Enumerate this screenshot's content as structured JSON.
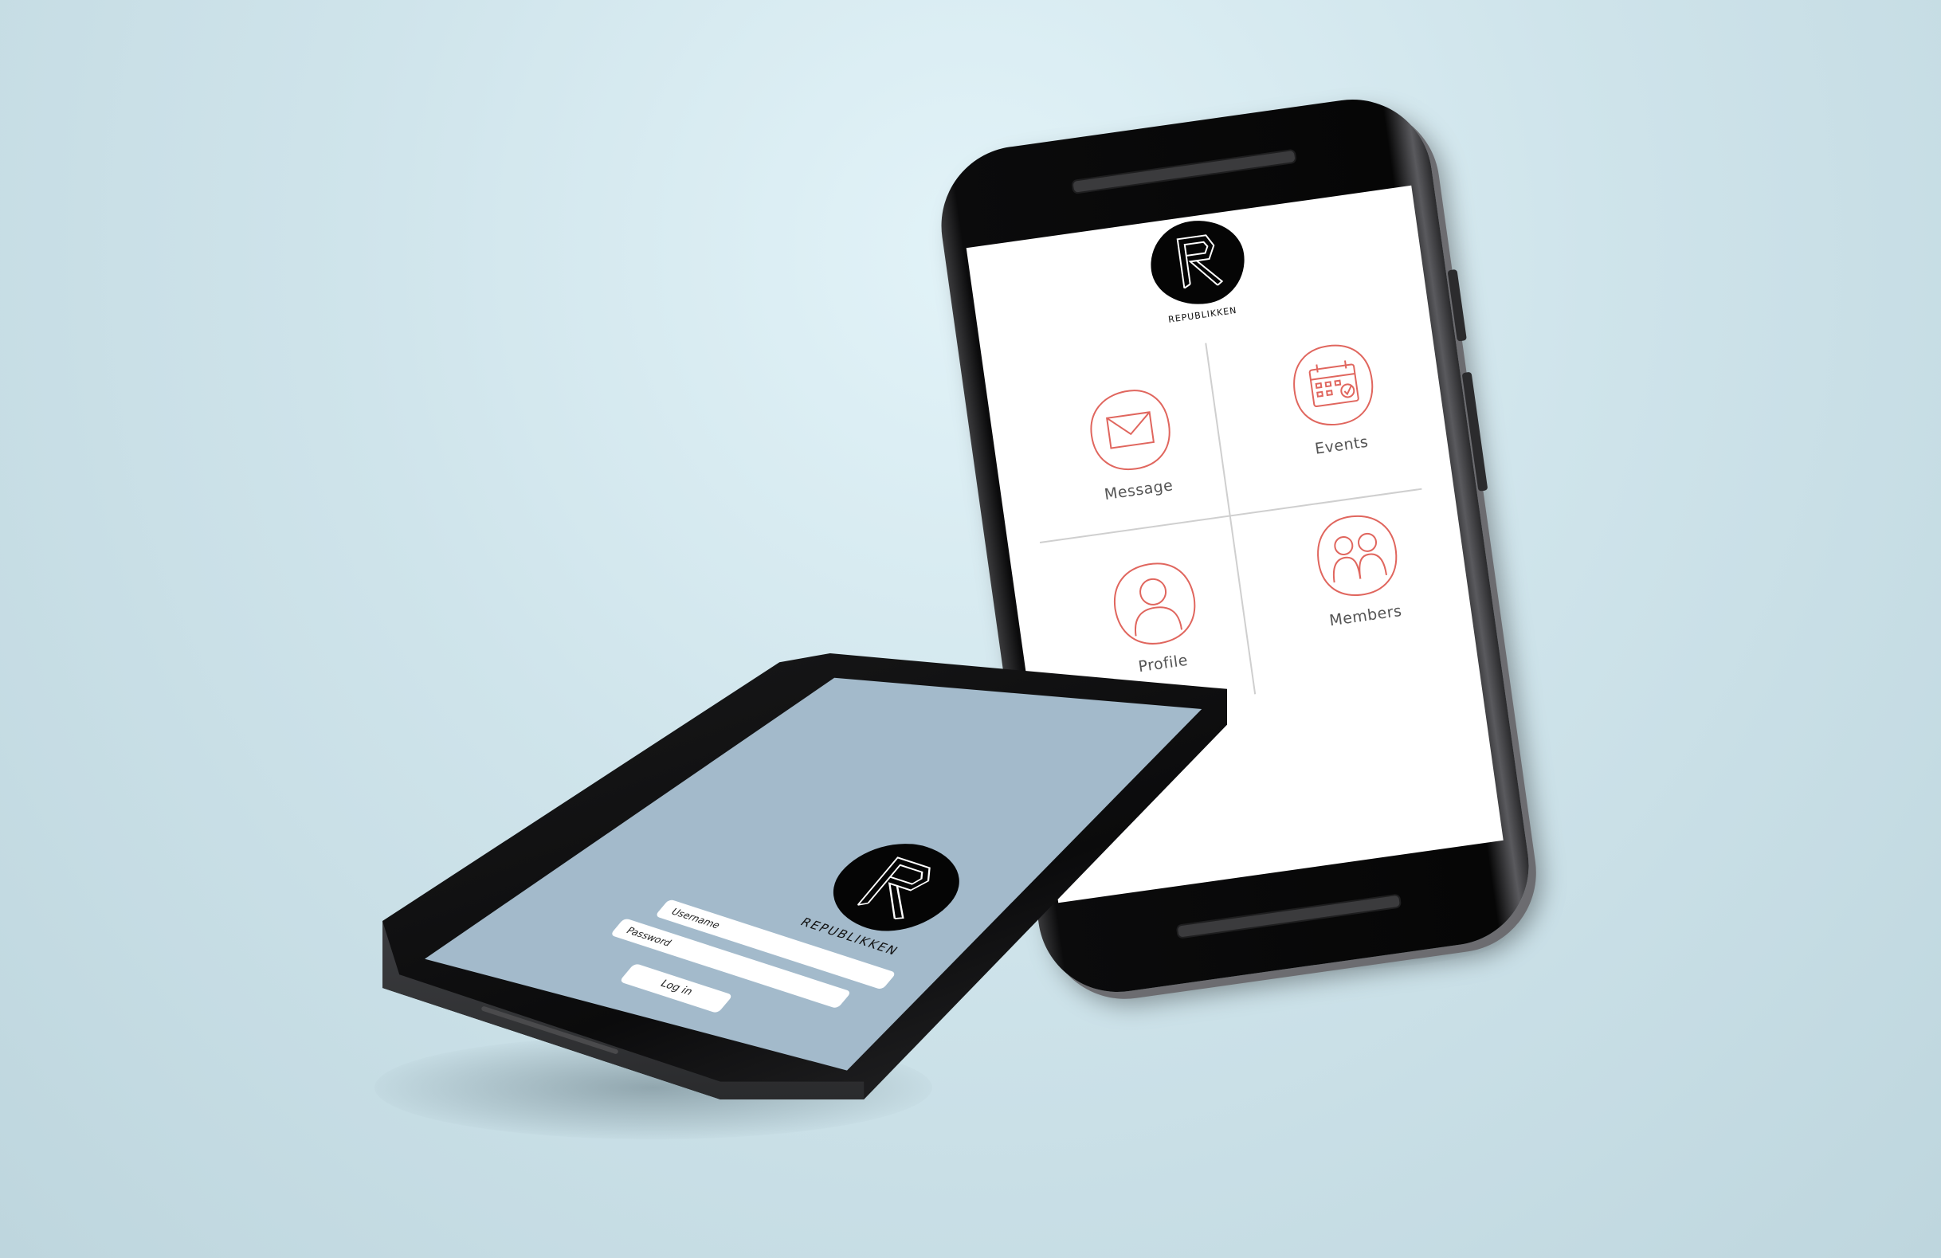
{
  "home_screen": {
    "brand": "REPUBLIKKEN",
    "menu": [
      {
        "label": "Message",
        "icon": "envelope-icon"
      },
      {
        "label": "Events",
        "icon": "calendar-icon"
      },
      {
        "label": "Profile",
        "icon": "person-icon"
      },
      {
        "label": "Members",
        "icon": "group-icon"
      }
    ],
    "accent_color": "#e0665e"
  },
  "login_screen": {
    "brand": "REPUBLIKKEN",
    "username_placeholder": "Username",
    "password_placeholder": "Password",
    "login_button": "Log in",
    "background_color": "#a3bacb"
  }
}
